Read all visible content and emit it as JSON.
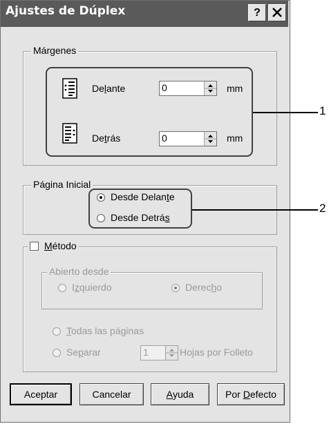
{
  "window": {
    "title": "Ajustes de Dúplex",
    "help_glyph": "?",
    "close_glyph": "✕"
  },
  "margins": {
    "legend": "Márgenes",
    "front": {
      "pre": "De",
      "mn": "l",
      "post": "ante",
      "value": "0"
    },
    "back": {
      "pre": "De",
      "mn": "t",
      "post": "rás",
      "value": "0"
    },
    "unit": "mm"
  },
  "start_page": {
    "legend": "Página Inicial",
    "opt_front": {
      "pre": "Desde Delan",
      "mn": "t",
      "post": "e",
      "selected": true
    },
    "opt_back": {
      "pre": "Desde Detrá",
      "mn": "s",
      "post": "",
      "selected": false
    }
  },
  "method": {
    "checkbox": {
      "pre": "",
      "mn": "M",
      "post": "étodo",
      "checked": false
    },
    "open_from": {
      "legend": "Abierto desde",
      "left": {
        "pre": "I",
        "mn": "z",
        "post": "quierdo",
        "selected": false
      },
      "right": {
        "pre": "Derec",
        "mn": "h",
        "post": "o",
        "selected": true
      }
    },
    "all_pages": {
      "pre": "",
      "mn": "T",
      "post": "odas las páginas",
      "selected": false
    },
    "separate": {
      "pre": "Se",
      "mn": "p",
      "post": "arar",
      "selected": false
    },
    "sheets_value": "1",
    "sheets_label": "Hojas por Folleto"
  },
  "buttons": {
    "ok": "Aceptar",
    "cancel": "Cancelar",
    "help": {
      "pre": "",
      "mn": "A",
      "post": "yuda"
    },
    "default": {
      "pre": "Por ",
      "mn": "D",
      "post": "efecto"
    }
  },
  "callouts": {
    "one": "1",
    "two": "2"
  }
}
